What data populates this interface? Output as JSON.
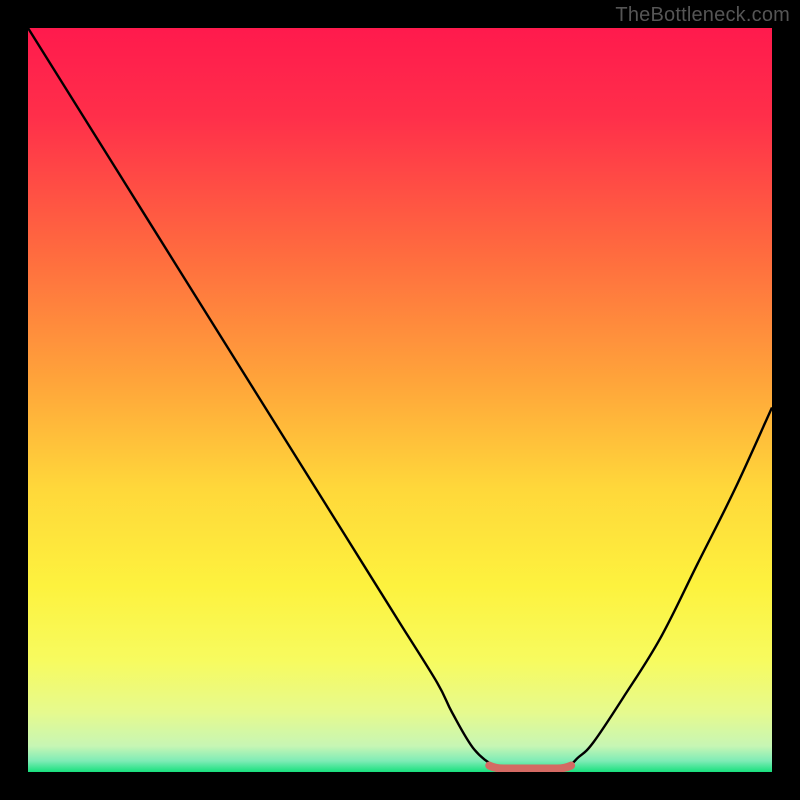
{
  "watermark": "TheBottleneck.com",
  "colors": {
    "frame": "#000000",
    "gradient_stops": [
      {
        "offset": 0.0,
        "color": "#ff1a4d"
      },
      {
        "offset": 0.12,
        "color": "#ff2f4a"
      },
      {
        "offset": 0.3,
        "color": "#ff6a3f"
      },
      {
        "offset": 0.48,
        "color": "#ffa63a"
      },
      {
        "offset": 0.62,
        "color": "#ffd83a"
      },
      {
        "offset": 0.75,
        "color": "#fdf23e"
      },
      {
        "offset": 0.85,
        "color": "#f7fb5f"
      },
      {
        "offset": 0.92,
        "color": "#e6fa8e"
      },
      {
        "offset": 0.965,
        "color": "#c7f6b4"
      },
      {
        "offset": 0.985,
        "color": "#7fecb6"
      },
      {
        "offset": 1.0,
        "color": "#18e07e"
      }
    ],
    "curve": "#000000",
    "marker": "#d46a63"
  },
  "chart_data": {
    "type": "line",
    "title": "",
    "xlabel": "",
    "ylabel": "",
    "xlim": [
      0,
      100
    ],
    "ylim": [
      0,
      100
    ],
    "grid": false,
    "legend": null,
    "series": [
      {
        "name": "bottleneck-curve",
        "x": [
          0,
          5,
          10,
          15,
          20,
          25,
          30,
          35,
          40,
          45,
          50,
          55,
          57,
          60,
          63,
          64,
          67,
          72,
          74,
          76,
          80,
          85,
          90,
          95,
          100
        ],
        "y": [
          100,
          92,
          84,
          76,
          68,
          60,
          52,
          44,
          36,
          28,
          20,
          12,
          8,
          3,
          0.6,
          0.4,
          0.4,
          0.6,
          2,
          4,
          10,
          18,
          28,
          38,
          49
        ]
      }
    ],
    "flat_region": {
      "x_start": 62,
      "x_end": 73,
      "y": 0.6
    },
    "annotations": []
  }
}
